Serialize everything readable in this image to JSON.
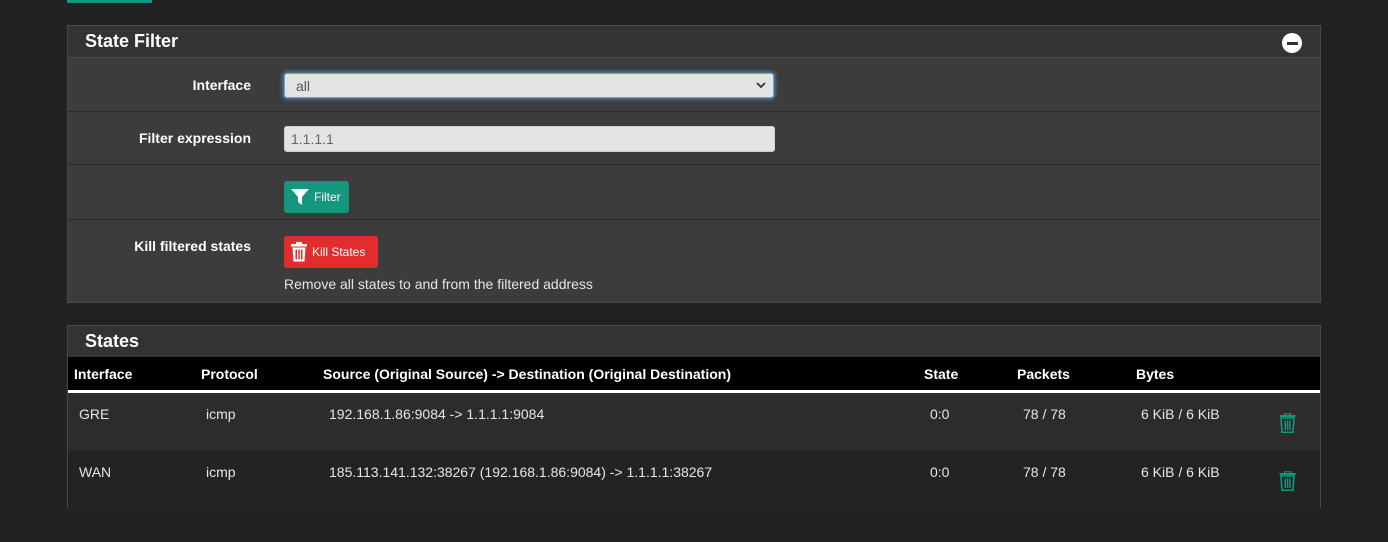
{
  "colors": {
    "accent": "#14967f",
    "danger": "#e12d2d"
  },
  "state_filter": {
    "title": "State Filter",
    "collapse_icon": "minus-circle-icon",
    "interface": {
      "label": "Interface",
      "value": "all"
    },
    "filter_expression": {
      "label": "Filter expression",
      "placeholder": "1.1.1.1"
    },
    "filter_button": {
      "label": "Filter",
      "icon": "funnel-icon"
    },
    "kill": {
      "label": "Kill filtered states",
      "button_label": "Kill States",
      "icon": "trash-icon",
      "help": "Remove all states to and from the filtered address"
    }
  },
  "states": {
    "title": "States",
    "columns": [
      "Interface",
      "Protocol",
      "Source (Original Source) -> Destination (Original Destination)",
      "State",
      "Packets",
      "Bytes"
    ],
    "rows": [
      {
        "interface": "GRE",
        "protocol": "icmp",
        "source_dest": "192.168.1.86:9084 -> 1.1.1.1:9084",
        "state": "0:0",
        "packets": "78 / 78",
        "bytes": "6 KiB / 6 KiB"
      },
      {
        "interface": "WAN",
        "protocol": "icmp",
        "source_dest": "185.113.141.132:38267 (192.168.1.86:9084) -> 1.1.1.1:38267",
        "state": "0:0",
        "packets": "78 / 78",
        "bytes": "6 KiB / 6 KiB"
      }
    ]
  }
}
